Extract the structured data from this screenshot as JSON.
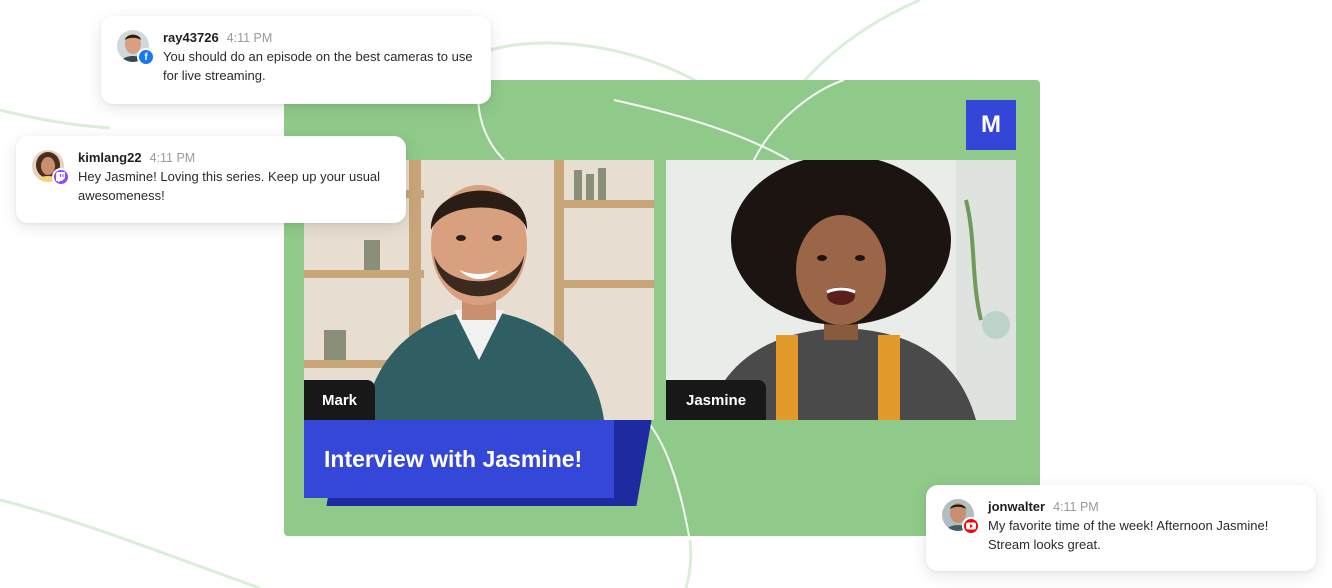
{
  "stage": {
    "logo_letter": "M",
    "participants": [
      {
        "name": "Mark"
      },
      {
        "name": "Jasmine"
      }
    ],
    "lower_third": "Interview with Jasmine!"
  },
  "comments": [
    {
      "username": "ray43726",
      "time": "4:11 PM",
      "text": "You should do an episode on the best cameras to use for live streaming.",
      "platform_icon": "facebook-icon"
    },
    {
      "username": "kimlang22",
      "time": "4:11 PM",
      "text": "Hey Jasmine! Loving this series. Keep up your usual awesomeness!",
      "platform_icon": "twitch-icon"
    },
    {
      "username": "jonwalter",
      "time": "4:11 PM",
      "text": "My favorite time of the week! Afternoon Jasmine! Stream looks great.",
      "platform_icon": "youtube-icon"
    }
  ],
  "colors": {
    "stage_bg": "#8fca8a",
    "brand_blue": "#3547d8",
    "facebook": "#1877f2",
    "twitch": "#9146ff",
    "youtube": "#ff0000"
  }
}
